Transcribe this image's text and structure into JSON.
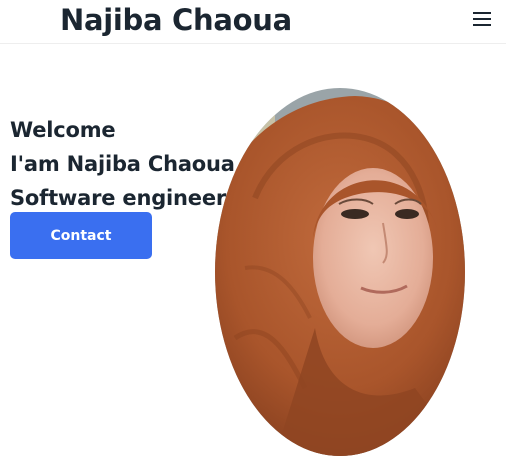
{
  "header": {
    "brand_name": "Najiba Chaoua",
    "menu_icon": "hamburger-menu-icon"
  },
  "hero": {
    "welcome": "Welcome",
    "intro": "I'am Najiba Chaoua",
    "role": "Software engineer",
    "contact_label": "Contact"
  },
  "colors": {
    "brand_text": "#1b2631",
    "accent": "#3a6ff0",
    "background": "#ffffff"
  }
}
